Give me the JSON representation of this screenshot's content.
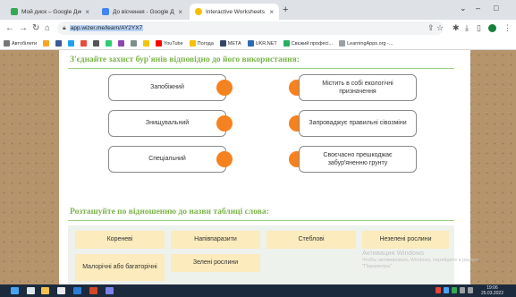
{
  "browser": {
    "tabs": [
      {
        "title": "Мой диск – Google Диск",
        "favicon_color": "#34a853",
        "active": false
      },
      {
        "title": "До вісчення - Google Докуме",
        "favicon_color": "#4285f4",
        "active": false
      },
      {
        "title": "Interactive Worksheets | Wizer.m",
        "favicon_color": "#f5c000",
        "active": true
      }
    ],
    "new_tab_symbol": "+",
    "window_controls": {
      "chevron": "⌄",
      "minimize": "–",
      "maximize": "□"
    },
    "url": "app.wizer.me/learn/AY2YX7",
    "bookmarks": [
      {
        "label": "Автобілети",
        "color": "#5b9bd5"
      },
      {
        "label": "",
        "color": "#f5a623"
      },
      {
        "label": "",
        "color": "#3b5998"
      },
      {
        "label": "",
        "color": "#1da1f2"
      },
      {
        "label": "",
        "color": "#e74c3c"
      },
      {
        "label": "",
        "color": "#555555"
      },
      {
        "label": "",
        "color": "#2ecc71"
      },
      {
        "label": "",
        "color": "#8e44ad"
      },
      {
        "label": "",
        "color": "#7f8c8d"
      },
      {
        "label": "",
        "color": "#f1c40f"
      },
      {
        "label": "YouTube",
        "color": "#ff0000"
      },
      {
        "label": "Погода",
        "color": "#f5c000"
      },
      {
        "label": "META",
        "color": "#334466"
      },
      {
        "label": "UKR.NET",
        "color": "#2b6cb0"
      },
      {
        "label": "Свєжий професі...",
        "color": "#27ae60"
      },
      {
        "label": "LearningApps.org -...",
        "color": "#9aa0a6"
      }
    ]
  },
  "worksheet": {
    "task1": {
      "heading": "З'єднайте захист бур'янів відповідно до його використання:",
      "left": [
        "Запобіжний",
        "Знищувальний",
        "Спеціальний"
      ],
      "right": [
        "Містить в собі екологічні призначення",
        "Запроваджує правильні сівозміни",
        "Своєчасно прешкоджає забур'яненню грунту"
      ],
      "dot_color": "#f58220"
    },
    "task2": {
      "heading": "Розташуйте по відношенню до назви таблиці слова:",
      "chips_row1": [
        "Кореневі",
        "Напівпаразити",
        "Стеблові",
        "Незелені рослини"
      ],
      "chips_row2": [
        "Малорічні або багаторічні",
        "Зелені рослини"
      ]
    }
  },
  "watermark": {
    "line1": "Активация Windows",
    "line2": "Чтобы активировать Windows, перейдите в раздел \"Параметры\"."
  },
  "taskbar": {
    "time": "19:06",
    "date": "25.03.2022"
  },
  "colors": {
    "accent_green": "#7ab44a",
    "orange": "#f58220",
    "chip_bg": "#fbebbd",
    "cork": "#b5936b"
  }
}
